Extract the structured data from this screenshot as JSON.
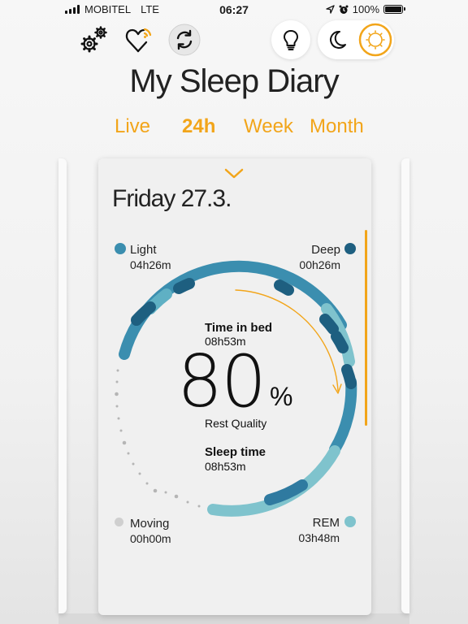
{
  "status_bar": {
    "carrier": "MOBITEL",
    "network": "LTE",
    "time": "06:27",
    "battery": "100%"
  },
  "toolbar": {
    "settings_icon": "gears-icon",
    "sync_icon": "heart-wireless-icon",
    "refresh_icon": "refresh-icon",
    "light_icon": "lightbulb-icon",
    "night_icon": "moon-icon",
    "day_icon": "sun-icon"
  },
  "app_title": "My Sleep Diary",
  "tabs": [
    {
      "label": "Live",
      "active": false
    },
    {
      "label": "24h",
      "active": true
    },
    {
      "label": "Week",
      "active": false
    },
    {
      "label": "Month",
      "active": false
    }
  ],
  "card": {
    "date": "Friday 27.3.",
    "legend": {
      "light": {
        "label": "Light",
        "value": "04h26m",
        "color": "#3b8eaf"
      },
      "deep": {
        "label": "Deep",
        "value": "00h26m",
        "color": "#1e5f80"
      },
      "moving": {
        "label": "Moving",
        "value": "00h00m",
        "color": "#cfcfcf"
      },
      "rem": {
        "label": "REM",
        "value": "03h48m",
        "color": "#7fc3cd"
      }
    },
    "time_in_bed_label": "Time in bed",
    "time_in_bed_value": "08h53m",
    "quality_value": "80",
    "quality_unit": "%",
    "quality_label": "Rest Quality",
    "sleep_time_label": "Sleep time",
    "sleep_time_value": "08h53m"
  },
  "colors": {
    "accent": "#f2a51a",
    "light": "#3b8eaf",
    "deep": "#1e5f80",
    "rem": "#7fc3cd"
  }
}
